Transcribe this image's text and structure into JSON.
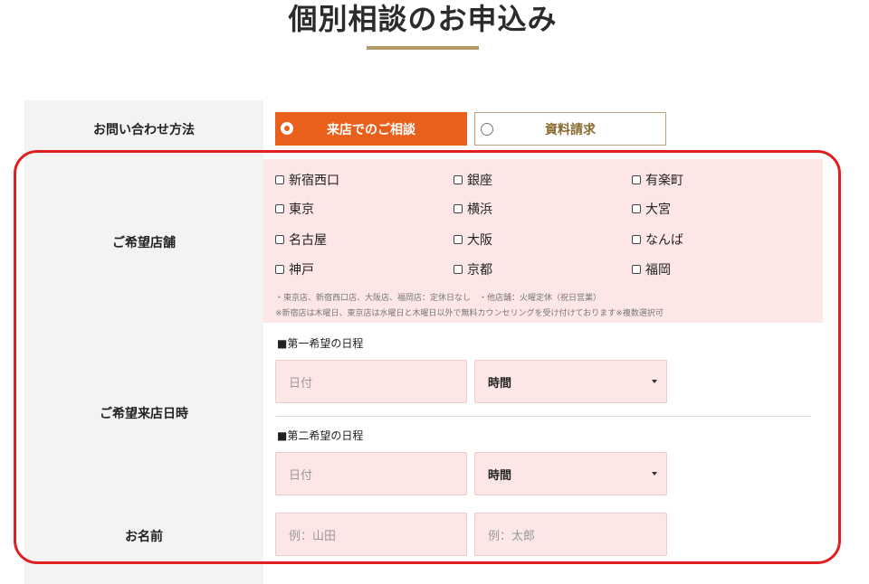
{
  "page": {
    "title": "個別相談のお申込み"
  },
  "contact_method": {
    "label": "お問い合わせ方法",
    "options": [
      {
        "label": "来店でのご相談",
        "selected": true
      },
      {
        "label": "資料請求",
        "selected": false
      }
    ]
  },
  "stores": {
    "label": "ご希望店舗",
    "items": [
      "新宿西口",
      "銀座",
      "有楽町",
      "東京",
      "横浜",
      "大宮",
      "名古屋",
      "大阪",
      "なんば",
      "神戸",
      "京都",
      "福岡"
    ],
    "note1": "・東京店、新宿西口店、大阪店、福岡店：定休日なし　・他店舗：火曜定休（祝日営業）",
    "note2": "※新宿店は木曜日、東京店は水曜日と木曜日以外で無料カウンセリングを受け付けております※複数選択可"
  },
  "visit_datetime": {
    "label": "ご希望来店日時",
    "first": {
      "heading": "■第一希望の日程",
      "date_placeholder": "日付",
      "time_value": "時間"
    },
    "second": {
      "heading": "■第二希望の日程",
      "date_placeholder": "日付",
      "time_value": "時間"
    }
  },
  "name": {
    "label": "お名前",
    "last_placeholder": "例：山田",
    "first_placeholder": "例：太郎"
  },
  "colors": {
    "accent_orange": "#e8601c",
    "gold_rule": "#b29a63",
    "field_pink": "#fde6e6",
    "highlight_red": "#e02020"
  }
}
